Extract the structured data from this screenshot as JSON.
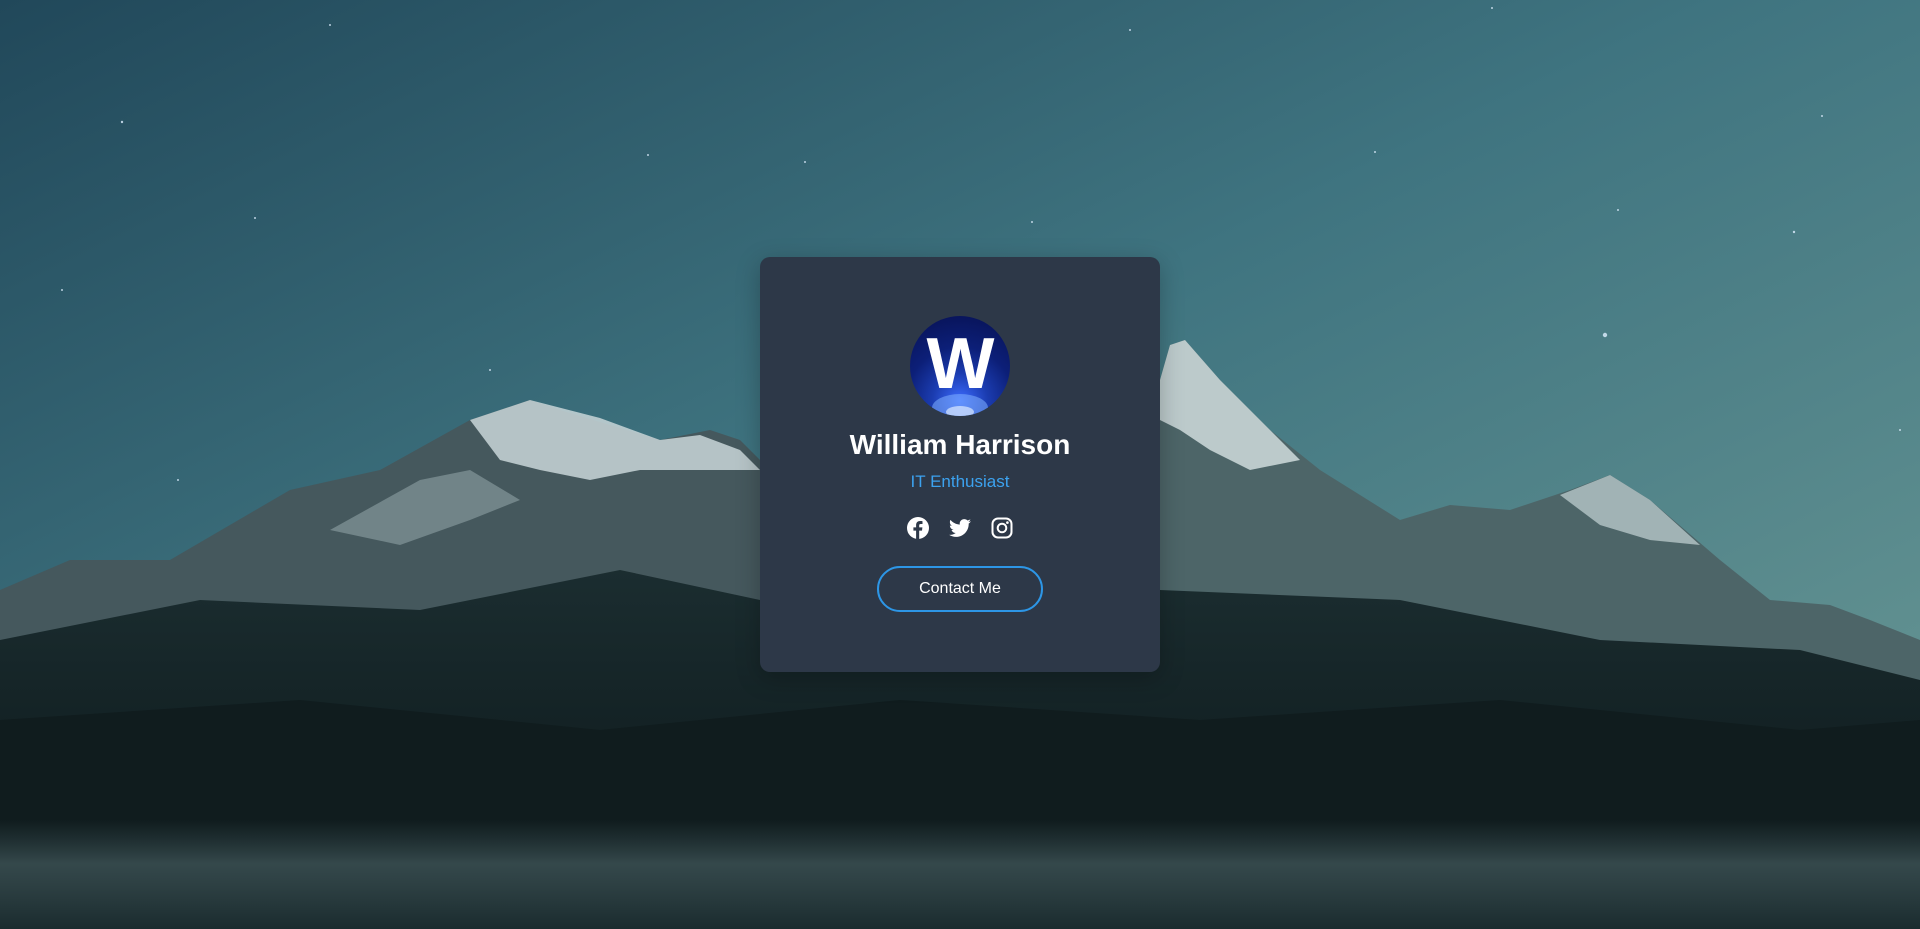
{
  "profile": {
    "avatar_letter": "W",
    "name": "William Harrison",
    "title": "IT Enthusiast"
  },
  "social": [
    {
      "icon": "facebook-icon"
    },
    {
      "icon": "twitter-icon"
    },
    {
      "icon": "instagram-icon"
    }
  ],
  "contact_button": {
    "label": "Contact Me"
  },
  "colors": {
    "card_background": "#2d3848",
    "accent": "#3ca2ef",
    "button_border": "#2d96e6",
    "text": "#ffffff"
  }
}
